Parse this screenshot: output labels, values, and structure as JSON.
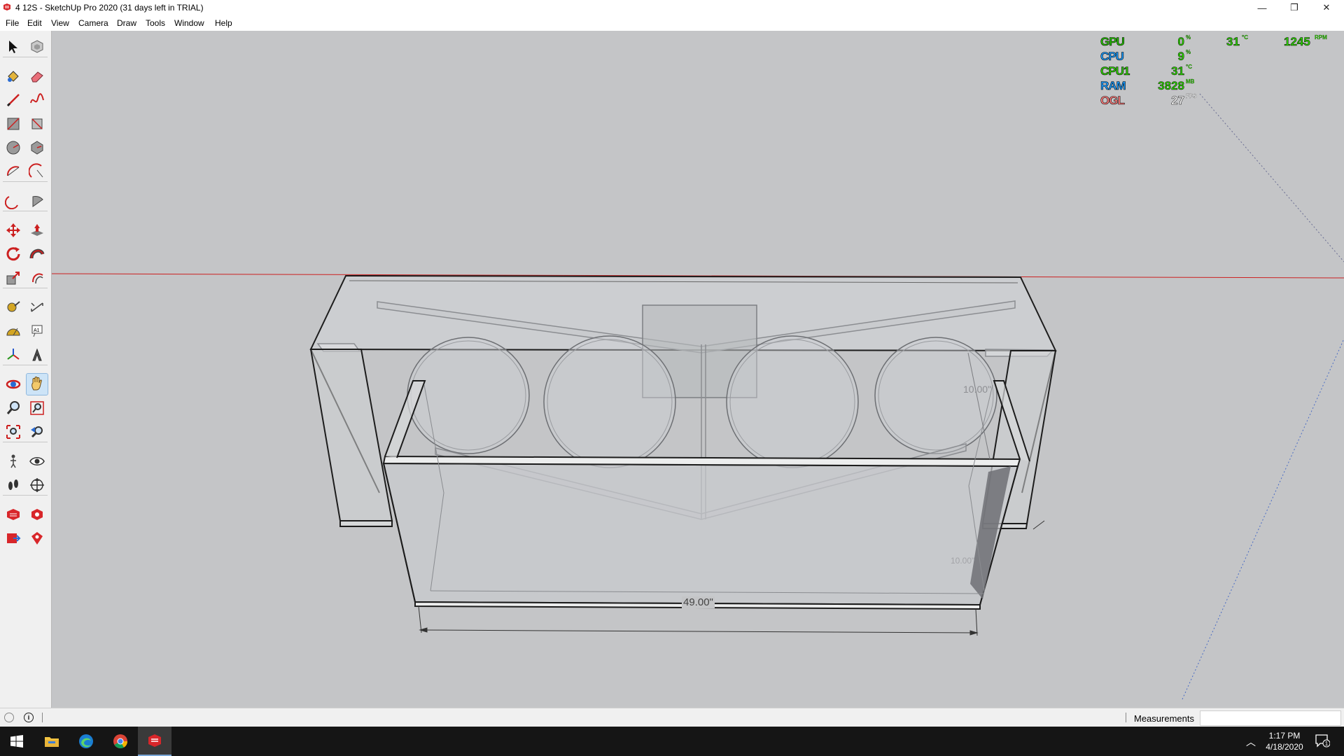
{
  "window": {
    "title": "4 12S - SketchUp Pro 2020 (31 days left in TRIAL)",
    "controls": {
      "minimize": "—",
      "maximize": "❐",
      "close": "✕"
    }
  },
  "menu": {
    "items": [
      "File",
      "Edit",
      "View",
      "Camera",
      "Draw",
      "Tools",
      "Window",
      "Help"
    ]
  },
  "toolbar": {
    "tools": [
      "select-icon",
      "make-component-icon",
      "paint-bucket-icon",
      "eraser-icon",
      "line-icon",
      "freehand-icon",
      "rectangle-icon",
      "rotated-rectangle-icon",
      "circle-icon",
      "polygon-icon",
      "arc-icon",
      "2-point-arc-icon",
      "3-point-arc-icon",
      "pie-icon",
      "move-icon",
      "push-pull-icon",
      "rotate-icon",
      "follow-me-icon",
      "scale-icon",
      "offset-icon",
      "tape-measure-icon",
      "dimension-icon",
      "protractor-icon",
      "text-icon",
      "axes-icon",
      "3d-text-icon",
      "orbit-icon",
      "pan-icon",
      "zoom-icon",
      "zoom-window-icon",
      "zoom-extents-icon",
      "previous-view-icon",
      "position-camera-icon",
      "look-around-icon",
      "walk-icon",
      "section-plane-icon",
      "3d-warehouse-icon",
      "extension-warehouse-icon",
      "send-to-layout-icon",
      "extension-manager-icon"
    ],
    "active_tool": "pan-icon"
  },
  "viewport": {
    "dimensions": {
      "width_label": "49.00\"",
      "depth_label": "10.00\"",
      "depth_label_2": "10.00\""
    }
  },
  "hw_monitor": {
    "rows": [
      {
        "label": "GPU",
        "value": "0",
        "unit": "%"
      },
      {
        "label": "CPU",
        "value": "9",
        "unit": "%"
      },
      {
        "label": "CPU1",
        "value": "31",
        "unit": "°C"
      },
      {
        "label": "RAM",
        "value": "3828",
        "unit": "MB"
      },
      {
        "label": "OGL",
        "value": "27",
        "unit": "FPS"
      }
    ],
    "gpu_temp": {
      "value": "31",
      "unit": "°C"
    },
    "fan": {
      "value": "1245",
      "unit": "RPM"
    },
    "colors": {
      "gpu": "#26c400",
      "cpu": "#1a9cff",
      "cpu1": "#2dd400",
      "ram": "#1a9cff",
      "ogl": "#ff7b7b",
      "values": "#2dd400"
    }
  },
  "statusbar": {
    "measurements_label": "Measurements",
    "measurements_value": ""
  },
  "taskbar": {
    "apps": [
      "start-icon",
      "file-explorer-icon",
      "edge-icon",
      "chrome-icon",
      "sketchup-icon"
    ],
    "time": "1:17 PM",
    "date": "4/18/2020",
    "notifications": "1"
  }
}
